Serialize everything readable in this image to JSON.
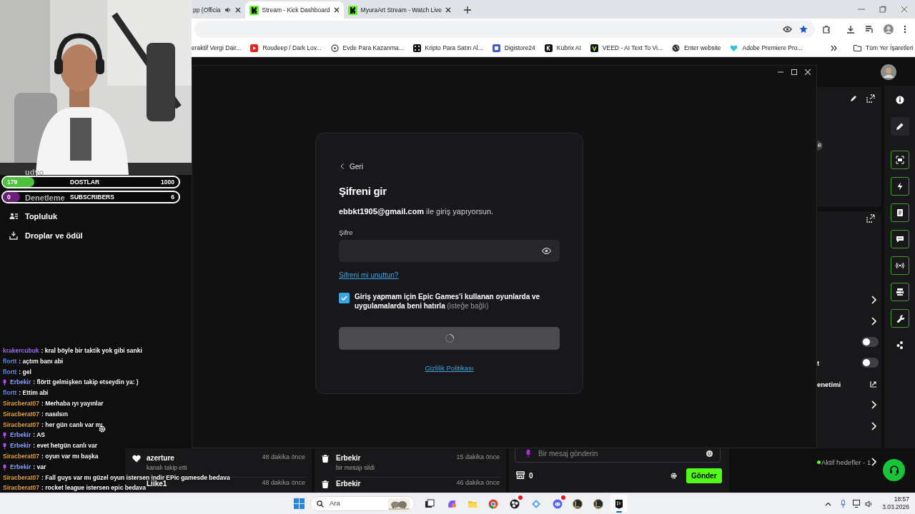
{
  "browser": {
    "tabs": [
      {
        "title": "pp (Officia",
        "selected": false,
        "audio": true
      },
      {
        "title": "Stream - Kick Dashboard",
        "selected": true,
        "audio": false,
        "kind": "kick"
      },
      {
        "title": "MyuraArt Stream - Watch Live",
        "selected": false,
        "audio": false,
        "kind": "kick"
      }
    ],
    "bookmarks": [
      {
        "title": "eraktif Vergi Dair..."
      },
      {
        "title": "Roudeep / Dark Lov...",
        "kind": "play"
      },
      {
        "title": "Evde Para Kazanma...",
        "kind": "knot"
      },
      {
        "title": "Kripto Para Satın Al...",
        "kind": "dice"
      },
      {
        "title": "Digistore24",
        "kind": "square"
      },
      {
        "title": "Kubrix AI",
        "kind": "k"
      },
      {
        "title": "VEED - AI Text To Vi...",
        "kind": "v"
      },
      {
        "title": "Enter website",
        "kind": "globe"
      },
      {
        "title": "Adobe Premiere Pro...",
        "kind": "heart"
      }
    ],
    "all_bookmarks": "Tüm Yer İşaretleri"
  },
  "overlay": {
    "goals": [
      {
        "count": "179",
        "title": "DOSTLAR",
        "target": "1000",
        "level": 0.18,
        "color": "#4cc13a"
      },
      {
        "count": "0",
        "title": "SUBSCRIBERS",
        "target": "6",
        "level": 0,
        "color": "#6b1f7a"
      }
    ],
    "chat": [
      {
        "user": "krakercubuk",
        "color": "#a06cf0",
        "mod": false,
        "text": ": kral böyle bir taktik yok gibi sanki"
      },
      {
        "user": "flortt",
        "color": "#5b8ef0",
        "mod": false,
        "text": ": açtım banı abi"
      },
      {
        "user": "flortt",
        "color": "#5b8ef0",
        "mod": false,
        "text": ": gel"
      },
      {
        "user": "Erbekir",
        "color": "#8da2f5",
        "mod": true,
        "text": ": flörtt gelmişken takip etseydin ya: )"
      },
      {
        "user": "flortt",
        "color": "#5b8ef0",
        "mod": false,
        "text": ": Ettim abi"
      },
      {
        "user": "Siracberat07",
        "color": "#e3a03a",
        "mod": false,
        "text": ": Merhaba ıyı yayınlar"
      },
      {
        "user": "Siracberat07",
        "color": "#e3a03a",
        "mod": false,
        "text": ": nasılsın"
      },
      {
        "user": "Siracberat07",
        "color": "#e3a03a",
        "mod": false,
        "text": ": her gün canlı var mı"
      },
      {
        "user": "Erbekir",
        "color": "#8da2f5",
        "mod": true,
        "text": ": AS"
      },
      {
        "user": "Erbekir",
        "color": "#8da2f5",
        "mod": true,
        "text": ": evet hetgün canlı var"
      },
      {
        "user": "Siracberat07",
        "color": "#e3a03a",
        "mod": false,
        "text": ": oyun var mı başka"
      },
      {
        "user": "Erbekir",
        "color": "#8da2f5",
        "mod": true,
        "text": ": var"
      },
      {
        "user": "Siracberat07",
        "color": "#e3a03a",
        "mod": false,
        "text": ": Fall guys var mı güzel oyun istersen indir EPic gamesde bedava"
      },
      {
        "user": "Siracberat07",
        "color": "#e3a03a",
        "mod": false,
        "text": ": rocket league istersen epic bedava"
      }
    ]
  },
  "sidebar": {
    "items": [
      {
        "label": "udyo"
      },
      {
        "label": "Denetleme"
      },
      {
        "label": "Topluluk",
        "kind": "people"
      },
      {
        "label": "Droplar ve ödül",
        "kind": "drop"
      }
    ]
  },
  "dialog": {
    "back": "Geri",
    "title": "Şifreni gir",
    "account_line": "**ebbkt1905@gmail.com** ile giriş yapıyorsun.",
    "password": {
      "label": "Şifre"
    },
    "forgot": "Şifreni mi unuttun?",
    "remember": {
      "checked": true,
      "label": "Giriş yapmam için Epic Games'i kullanan oyunlarda ve uygulamalarda beni hatırla",
      "hint": "(isteğe bağlı)"
    },
    "submit": {
      "loading": true
    },
    "privacy": "Gizlilik Politikası"
  },
  "right_panel": {
    "pill": "e",
    "rows": [
      {
        "kind": "chevron"
      },
      {
        "kind": "chevron"
      },
      {
        "kind": "toggle",
        "on": false
      },
      {
        "kind": "toggle",
        "label": "t",
        "on": false
      },
      {
        "kind": "external",
        "label": "enetimi"
      },
      {
        "kind": "chevron"
      },
      {
        "kind": "chevron"
      },
      {
        "kind": "goal",
        "label": "Aktif hedefler - 1"
      }
    ]
  },
  "rail": [
    {
      "kind": "info",
      "selected": false
    },
    {
      "kind": "pencil",
      "selected": true
    },
    {
      "kind": "screen",
      "selected": false
    },
    {
      "kind": "bolt",
      "selected": false
    },
    {
      "kind": "note",
      "selected": false
    },
    {
      "kind": "chat",
      "selected": false
    },
    {
      "kind": "broadcast",
      "selected": false
    },
    {
      "kind": "camera",
      "selected": false
    },
    {
      "kind": "wrench",
      "selected": false
    },
    {
      "kind": "dots",
      "selected": false
    }
  ],
  "activity": [
    [
      {
        "kind": "heart",
        "user": "azerture",
        "action": "kanalı takip etti",
        "time": "48 dakika önce"
      },
      {
        "user": "Liike1",
        "time": "48 dakika önce"
      }
    ],
    [
      {
        "kind": "trash",
        "user": "Erbekir",
        "action": "bir mesajı sildi",
        "time": "15 dakika önce"
      },
      {
        "kind": "trash",
        "user": "Erbekir",
        "time": "46 dakika önce"
      }
    ]
  ],
  "chat_box": {
    "placeholder": "Bir mesaj gönderin",
    "points": "0",
    "send": "Gönder"
  },
  "taskbar": {
    "search": "Ara",
    "apps": [
      {
        "kind": "taskview",
        "selected": false
      },
      {
        "kind": "copilot",
        "selected": false
      },
      {
        "kind": "folder",
        "selected": false
      },
      {
        "kind": "chrome",
        "selected": false
      },
      {
        "kind": "obs",
        "selected": false,
        "badge": true
      },
      {
        "kind": "network",
        "selected": false
      },
      {
        "kind": "discord",
        "selected": false,
        "badge": true
      },
      {
        "kind": "lol",
        "selected": false
      },
      {
        "kind": "lol",
        "selected": false
      },
      {
        "kind": "epic",
        "selected": true
      }
    ],
    "time": "18:57",
    "date": "3.03.2026"
  }
}
